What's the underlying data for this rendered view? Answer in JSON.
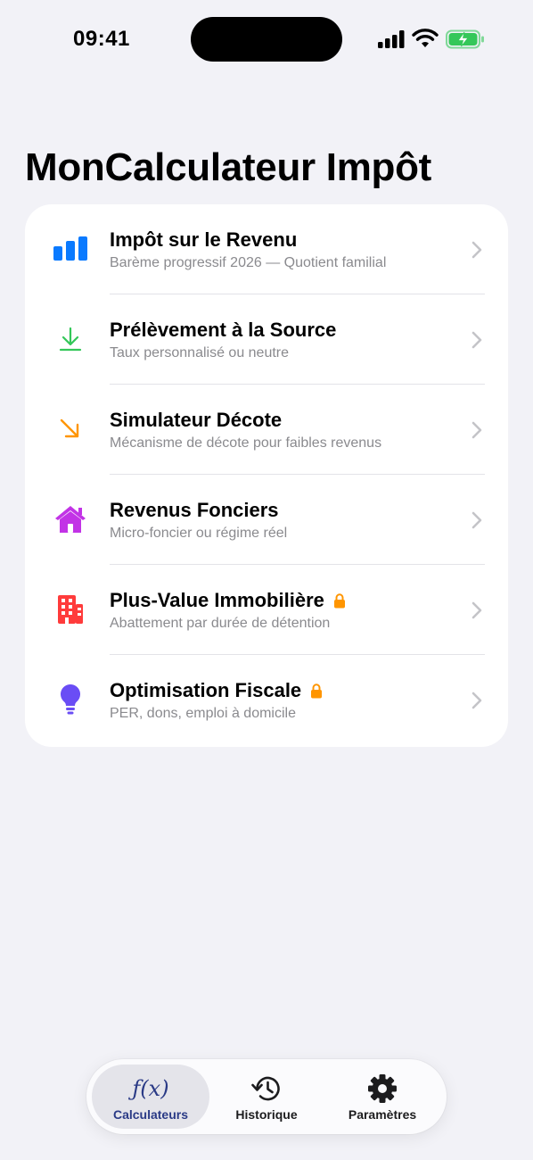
{
  "status": {
    "time": "09:41"
  },
  "header": {
    "title": "MonCalculateur Impôt"
  },
  "calculators": [
    {
      "title": "Impôt sur le Revenu",
      "subtitle": "Barème progressif 2026 — Quotient familial",
      "icon": "bar-chart-icon",
      "color": "#0a7aff",
      "locked": false
    },
    {
      "title": "Prélèvement à la Source",
      "subtitle": "Taux personnalisé ou neutre",
      "icon": "download-arrow-icon",
      "color": "#34c759",
      "locked": false
    },
    {
      "title": "Simulateur Décote",
      "subtitle": "Mécanisme de décote pour faibles revenus",
      "icon": "diagonal-arrow-icon",
      "color": "#ff9500",
      "locked": false
    },
    {
      "title": "Revenus Fonciers",
      "subtitle": "Micro-foncier ou régime réel",
      "icon": "house-icon",
      "color": "#c233e6",
      "locked": false
    },
    {
      "title": "Plus-Value Immobilière",
      "subtitle": "Abattement par durée de détention",
      "icon": "building-icon",
      "color": "#ff3b3b",
      "locked": true
    },
    {
      "title": "Optimisation Fiscale",
      "subtitle": "PER, dons, emploi à domicile",
      "icon": "lightbulb-icon",
      "color": "#6a4df5",
      "locked": true
    }
  ],
  "tabbar": {
    "tabs": [
      {
        "label": "Calculateurs",
        "icon_text": "ƒ(x)",
        "active": true
      },
      {
        "label": "Historique",
        "active": false
      },
      {
        "label": "Paramètres",
        "active": false
      }
    ]
  },
  "colors": {
    "background": "#f2f2f7",
    "accent": "#2a3a86",
    "lock": "#ff9500"
  }
}
